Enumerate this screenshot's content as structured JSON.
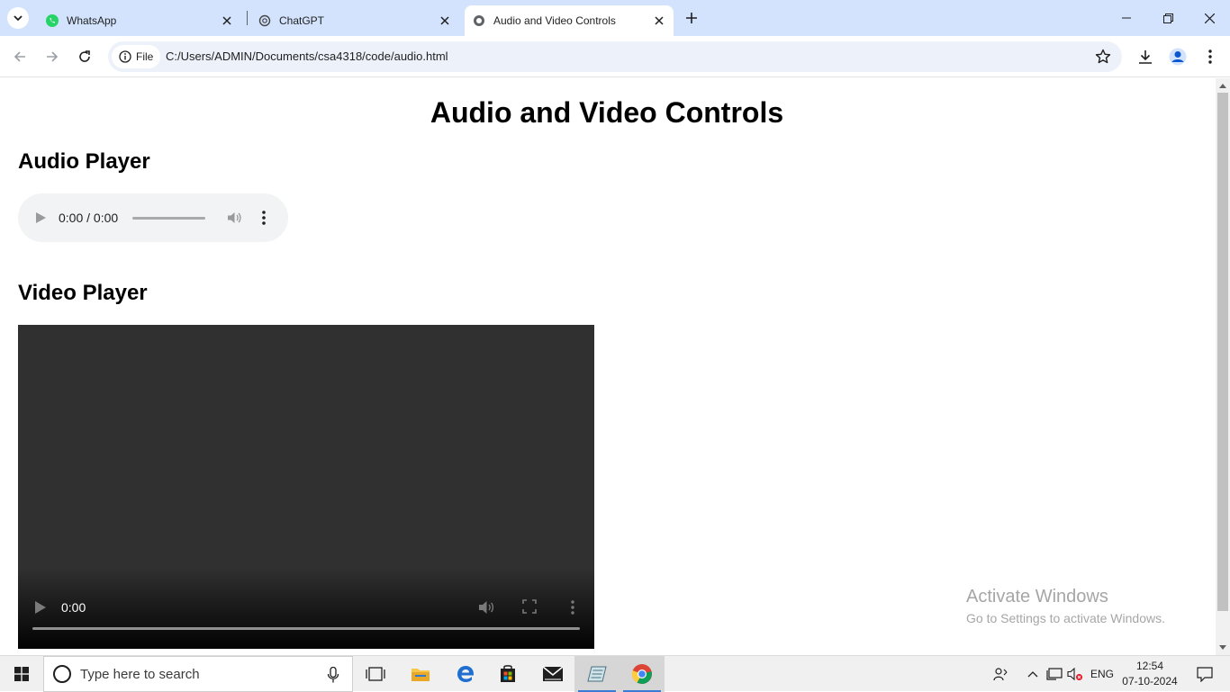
{
  "browser": {
    "tabs": [
      {
        "title": "WhatsApp",
        "favicon": "whatsapp-icon",
        "active": false
      },
      {
        "title": "ChatGPT",
        "favicon": "chatgpt-icon",
        "active": false
      },
      {
        "title": "Audio and Video Controls",
        "favicon": "globe-icon",
        "active": true
      }
    ],
    "address": {
      "chip_label": "File",
      "url": "C:/Users/ADMIN/Documents/csa4318/code/audio.html"
    },
    "accent_color": "#0b57d0",
    "tabstrip_color": "#d3e3fd"
  },
  "page": {
    "title": "Audio and Video Controls",
    "audio_heading": "Audio Player",
    "video_heading": "Video Player",
    "audio_player": {
      "time": "0:00 / 0:00",
      "progress": 0
    },
    "video_player": {
      "time": "0:00",
      "progress": 0
    },
    "watermark": {
      "line1": "Activate Windows",
      "line2": "Go to Settings to activate Windows."
    }
  },
  "taskbar": {
    "search_placeholder": "Type here to search",
    "apps": [
      "task-view-icon",
      "file-explorer-icon",
      "edge-icon",
      "store-icon",
      "mail-icon",
      "notepad-icon",
      "chrome-icon"
    ],
    "active_app": "chrome-icon",
    "language": "ENG",
    "time": "12:54",
    "date": "07-10-2024"
  }
}
